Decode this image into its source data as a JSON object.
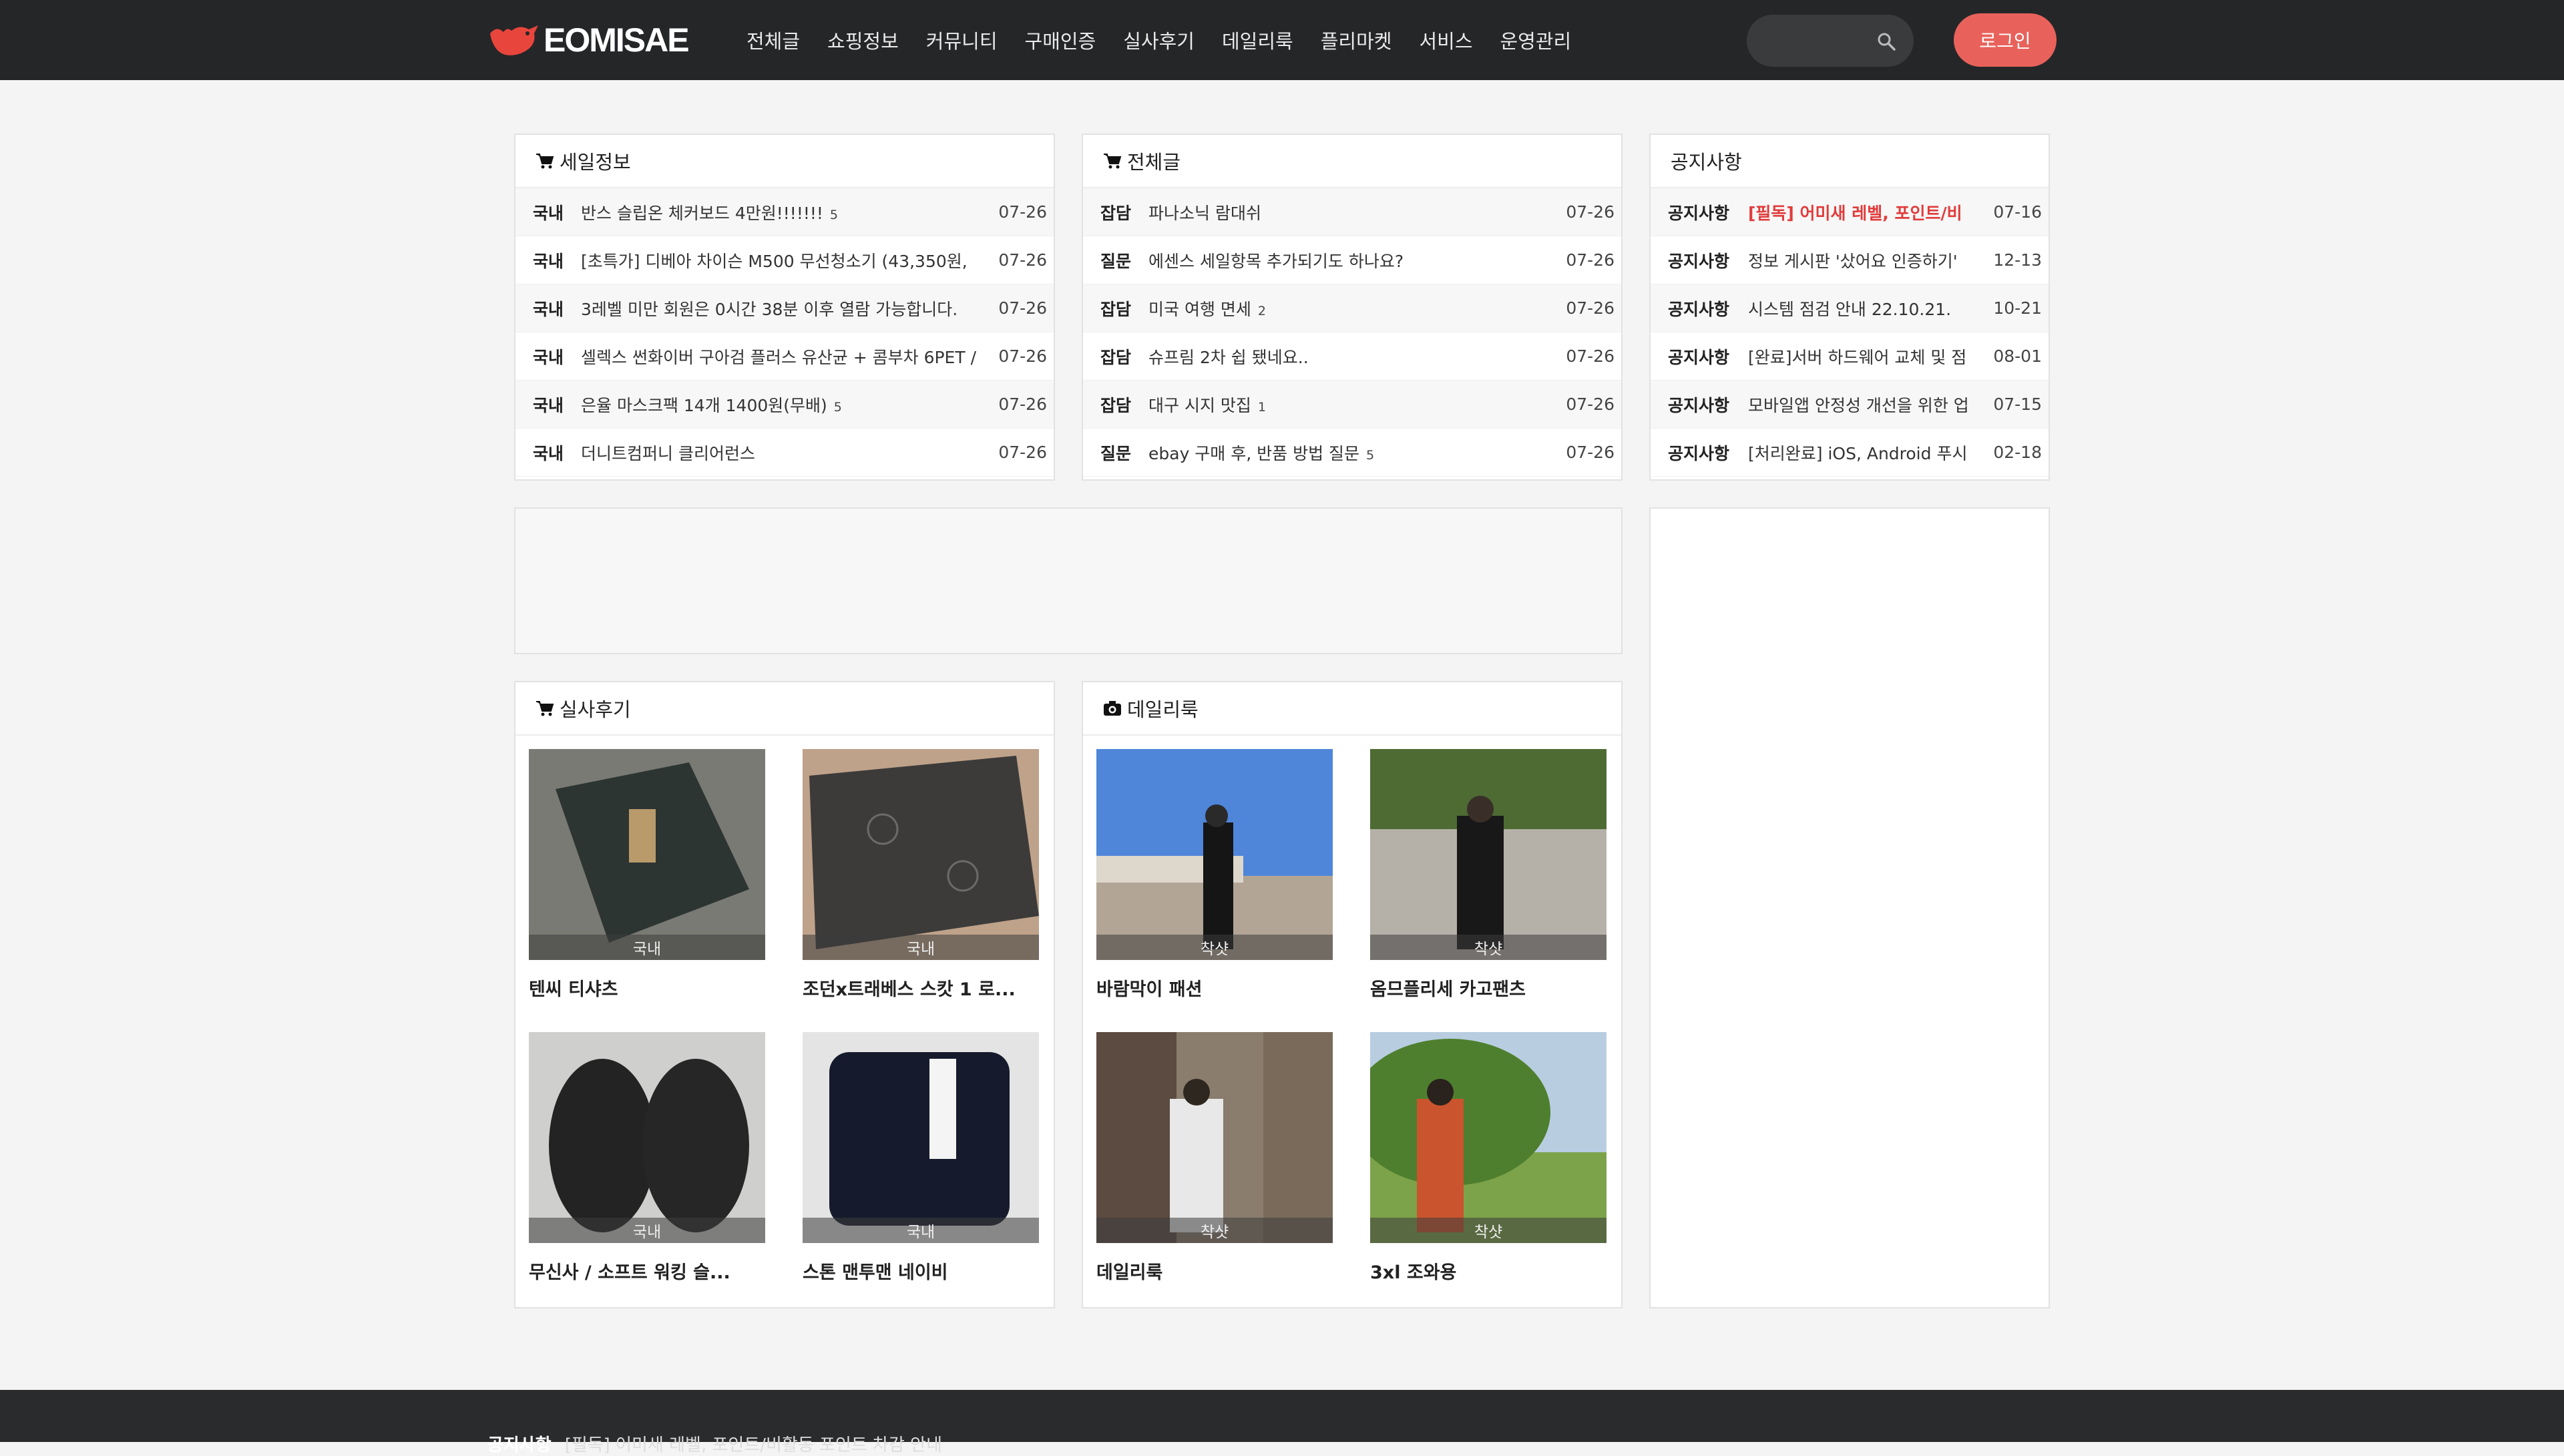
{
  "header": {
    "logo": "EOMISAE",
    "nav": [
      "전체글",
      "쇼핑정보",
      "커뮤니티",
      "구매인증",
      "실사후기",
      "데일리룩",
      "플리마켓",
      "서비스",
      "운영관리"
    ],
    "search_placeholder": "",
    "login_label": "로그인",
    "accent_color": "#e8625b"
  },
  "sale_panel": {
    "title": "세일정보",
    "rows": [
      {
        "tag": "국내",
        "title": "반스 슬립온 체커보드 4만원!!!!!!!",
        "comments": "5",
        "date": "07-26"
      },
      {
        "tag": "국내",
        "title": "[초특가] 디베아 차이슨 M500 무선청소기 (43,350원,",
        "comments": "",
        "date": "07-26"
      },
      {
        "tag": "국내",
        "title": "3레벨 미만 회원은 0시간 38분 이후 열람 가능합니다.",
        "comments": "",
        "date": "07-26"
      },
      {
        "tag": "국내",
        "title": "셀렉스 썬화이버 구아검 플러스 유산균 + 콤부차 6PET /",
        "comments": "",
        "date": "07-26"
      },
      {
        "tag": "국내",
        "title": "은율 마스크팩 14개 1400원(무배)",
        "comments": "5",
        "date": "07-26"
      },
      {
        "tag": "국내",
        "title": "더니트컴퍼니 클리어런스",
        "comments": "",
        "date": "07-26"
      }
    ]
  },
  "all_panel": {
    "title": "전체글",
    "rows": [
      {
        "tag": "잡담",
        "title": "파나소닉 람대쉬",
        "comments": "",
        "date": "07-26"
      },
      {
        "tag": "질문",
        "title": "에센스 세일항목 추가되기도 하나요?",
        "comments": "",
        "date": "07-26"
      },
      {
        "tag": "잡담",
        "title": "미국 여행 면세",
        "comments": "2",
        "date": "07-26"
      },
      {
        "tag": "잡담",
        "title": "슈프림 2차 쉽 됐네요..",
        "comments": "",
        "date": "07-26"
      },
      {
        "tag": "잡담",
        "title": "대구 시지 맛집",
        "comments": "1",
        "date": "07-26"
      },
      {
        "tag": "질문",
        "title": "ebay 구매 후, 반품 방법 질문",
        "comments": "5",
        "date": "07-26"
      }
    ]
  },
  "notice_panel": {
    "title": "공지사항",
    "rows": [
      {
        "tag": "공지사항",
        "title": "[필독] 어미새 레벨, 포인트/비",
        "date": "07-16",
        "highlight": true
      },
      {
        "tag": "공지사항",
        "title": "정보 게시판 '샀어요 인증하기'",
        "date": "12-13"
      },
      {
        "tag": "공지사항",
        "title": "시스템 점검 안내 22.10.21.",
        "date": "10-21"
      },
      {
        "tag": "공지사항",
        "title": "[완료]서버 하드웨어 교체 및 점",
        "date": "08-01"
      },
      {
        "tag": "공지사항",
        "title": "모바일앱 안정성 개선을 위한 업",
        "date": "07-15"
      },
      {
        "tag": "공지사항",
        "title": "[처리완료] iOS, Android 푸시",
        "date": "02-18"
      }
    ]
  },
  "review_panel": {
    "title": "실사후기",
    "items": [
      {
        "label": "국내",
        "caption": "텐씨 티샤츠"
      },
      {
        "label": "국내",
        "caption": "조던x트래베스 스캇 1 로..."
      },
      {
        "label": "국내",
        "caption": "무신사 / 소프트 워킹 슬..."
      },
      {
        "label": "국내",
        "caption": "스톤 맨투맨 네이비"
      }
    ]
  },
  "daily_panel": {
    "title": "데일리룩",
    "items": [
      {
        "label": "착샷",
        "caption": "바람막이 패션"
      },
      {
        "label": "착샷",
        "caption": "옴므플리세 카고팬츠"
      },
      {
        "label": "착샷",
        "caption": "데일리룩"
      },
      {
        "label": "착샷",
        "caption": "3xl 조와용"
      }
    ]
  },
  "footer": {
    "label": "공지사항",
    "text": "[필독] 어미새 레벨, 포인트/비활동 포인트 차감 안내"
  }
}
